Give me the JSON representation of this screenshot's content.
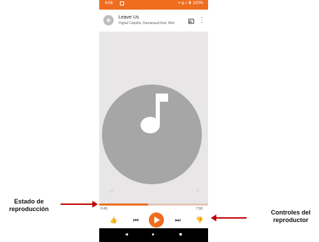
{
  "status_bar": {
    "time": "4:06 ",
    "right": "⌖ ⊕ ▾ ▮ 100%"
  },
  "now_playing": {
    "title": "Leave Us",
    "subtitle": "Digital Capella, Damanaud feat. Mist",
    "icons": {
      "artwork": "album-art-icon",
      "cast": "cast-icon",
      "more": "more-vert-icon"
    }
  },
  "player": {
    "artwork_icon": "music-note-icon",
    "shuffle_icon": "shuffle-icon",
    "repeat_icon": "repeat-icon",
    "elapsed": "0:45",
    "duration": "7:58",
    "progress_fraction": 0.45,
    "accent_color": "#ef6d1f"
  },
  "controls": {
    "thumbs_up": "👍",
    "previous": "⏮",
    "next": "⏭",
    "thumbs_down": "👎"
  },
  "navbar": {
    "back": "◄",
    "home": "●",
    "recents": "■"
  },
  "annotations": {
    "left": "Estado de reproducción",
    "right": "Controles del reproductor",
    "arrow_color": "#c00000"
  }
}
